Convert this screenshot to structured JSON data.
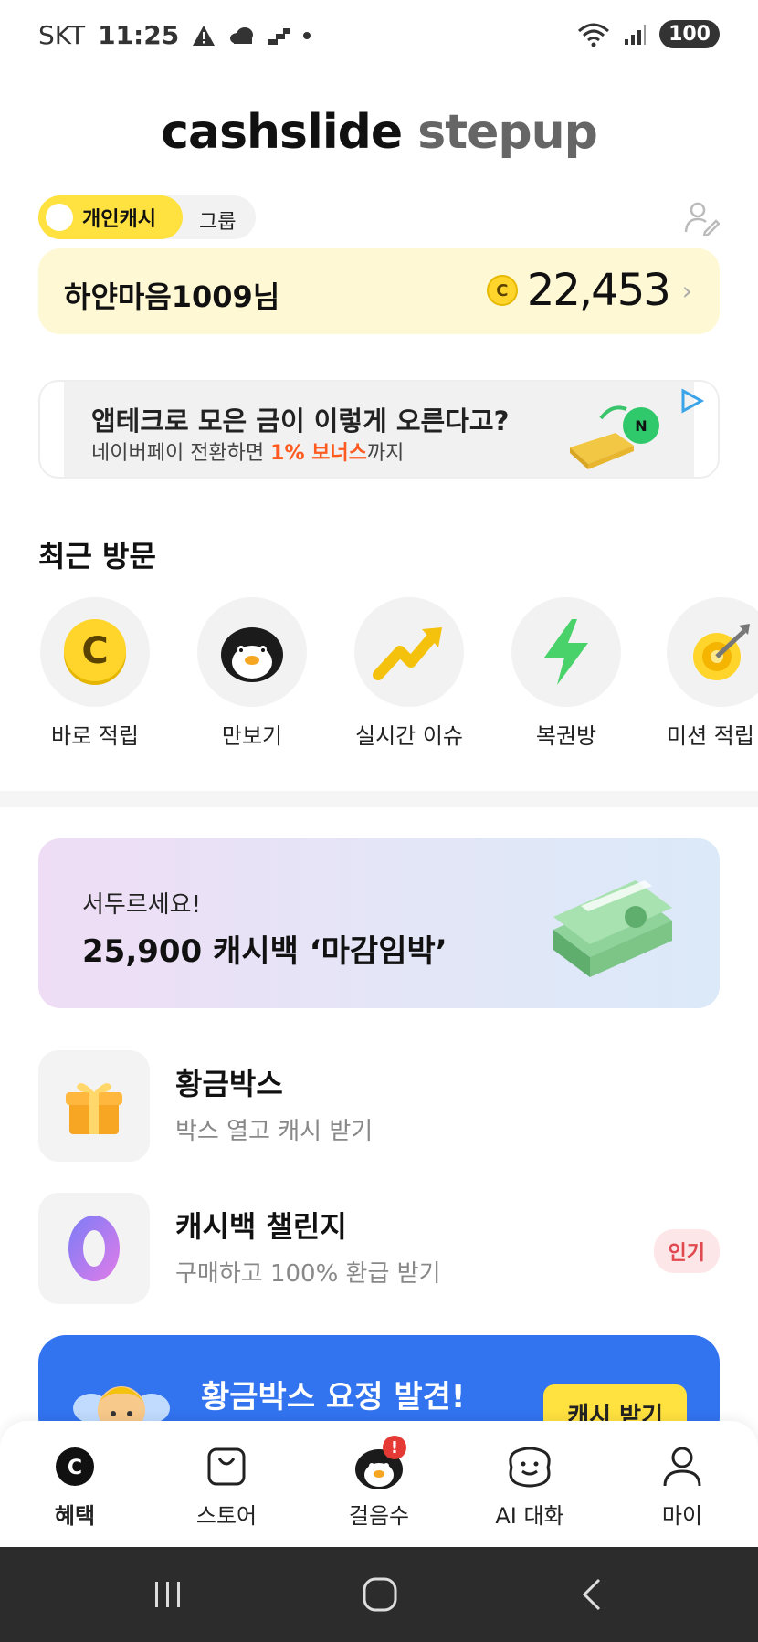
{
  "status_bar": {
    "carrier": "SKT",
    "time": "11:25",
    "battery": "100"
  },
  "logo": {
    "part1": "cashslide",
    "part2": "stepup"
  },
  "toggle": {
    "active_label": "개인캐시",
    "inactive_label": "그룹"
  },
  "balance_card": {
    "user_name": "하얀마음1009님",
    "coin_symbol": "C",
    "balance": "22,453"
  },
  "ad": {
    "title": "앱테크로 모은 금이 이렇게 오른다고?",
    "sub_prefix": "네이버페이 전환하면 ",
    "sub_highlight": "1% 보너스",
    "sub_suffix": "까지"
  },
  "recent": {
    "title": "최근 방문",
    "items": [
      {
        "label": "바로 적립",
        "icon": "coin-icon"
      },
      {
        "label": "만보기",
        "icon": "penguin-icon"
      },
      {
        "label": "실시간 이슈",
        "icon": "trend-arrow-icon"
      },
      {
        "label": "복권방",
        "icon": "lightning-icon"
      },
      {
        "label": "미션 적립",
        "icon": "target-icon"
      }
    ]
  },
  "promo": {
    "subtitle": "서두르세요!",
    "title": "25,900 캐시백 ‘마감임박’"
  },
  "list": [
    {
      "title": "황금박스",
      "subtitle": "박스 열고 캐시 받기",
      "icon": "gift-icon"
    },
    {
      "title": "캐시백 챌린지",
      "subtitle": "구매하고 100% 환급 받기",
      "icon": "zero-icon",
      "badge": "인기"
    }
  ],
  "blue_banner": {
    "title": "황금박스 요정 발견!",
    "button": "캐시 받기"
  },
  "bottom_nav": [
    {
      "label": "혜택",
      "icon": "benefit-icon",
      "active": true
    },
    {
      "label": "스토어",
      "icon": "bag-icon"
    },
    {
      "label": "걸음수",
      "icon": "penguin-icon"
    },
    {
      "label": "AI 대화",
      "icon": "chat-face-icon"
    },
    {
      "label": "마이",
      "icon": "person-icon"
    }
  ],
  "colors": {
    "accent_yellow": "#ffe13f",
    "card_yellow": "#fff8d4",
    "banner_blue": "#3273f0",
    "badge_red": "#e0494f"
  }
}
